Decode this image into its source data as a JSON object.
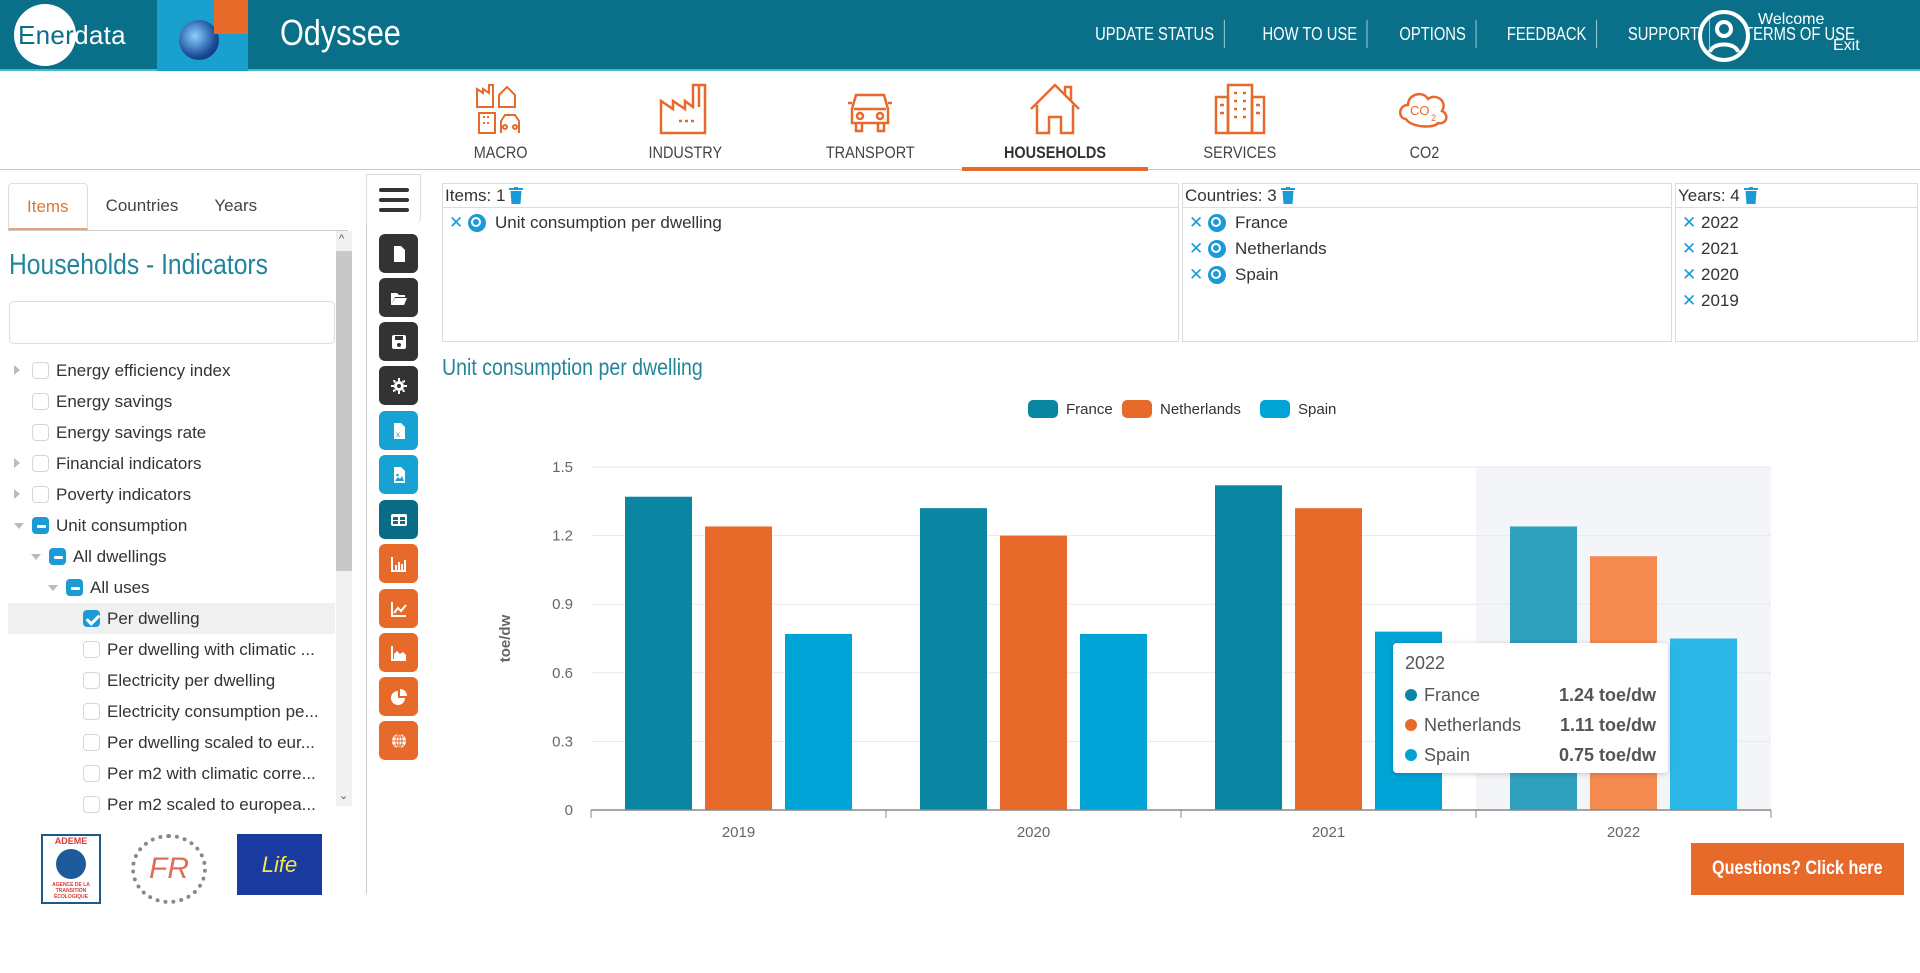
{
  "header": {
    "brand_left": "Ener",
    "brand_right": "data",
    "app_title": "Odyssee",
    "nav": [
      "UPDATE STATUS",
      "HOW TO USE",
      "OPTIONS",
      "FEEDBACK",
      "SUPPORT",
      "TERMS OF USE"
    ],
    "welcome": "Welcome",
    "exit": "Exit"
  },
  "categories": [
    {
      "label": "MACRO",
      "icon": "macro-icon",
      "active": false
    },
    {
      "label": "INDUSTRY",
      "icon": "factory-icon",
      "active": false
    },
    {
      "label": "TRANSPORT",
      "icon": "car-icon",
      "active": false
    },
    {
      "label": "HOUSEHOLDS",
      "icon": "house-icon",
      "active": true
    },
    {
      "label": "SERVICES",
      "icon": "building-icon",
      "active": false
    },
    {
      "label": "CO2",
      "icon": "co2-cloud-icon",
      "active": false
    }
  ],
  "left_panel": {
    "tabs": [
      "Items",
      "Countries",
      "Years"
    ],
    "active_tab": "Items",
    "title": "Households - Indicators",
    "search_value": "",
    "tree": [
      {
        "label": "Energy efficiency index",
        "level": 0,
        "caret": "right",
        "state": "unchecked"
      },
      {
        "label": "Energy savings",
        "level": 0,
        "caret": "none",
        "state": "unchecked"
      },
      {
        "label": "Energy savings rate",
        "level": 0,
        "caret": "none",
        "state": "unchecked"
      },
      {
        "label": "Financial indicators",
        "level": 0,
        "caret": "right",
        "state": "unchecked"
      },
      {
        "label": "Poverty indicators",
        "level": 0,
        "caret": "right",
        "state": "unchecked"
      },
      {
        "label": "Unit consumption",
        "level": 0,
        "caret": "down",
        "state": "partial"
      },
      {
        "label": "All dwellings",
        "level": 1,
        "caret": "down",
        "state": "partial"
      },
      {
        "label": "All uses",
        "level": 2,
        "caret": "down",
        "state": "partial"
      },
      {
        "label": "Per dwelling",
        "level": 3,
        "caret": "none",
        "state": "checked",
        "selected": true
      },
      {
        "label": "Per dwelling with climatic ...",
        "level": 3,
        "caret": "none",
        "state": "unchecked"
      },
      {
        "label": "Electricity per dwelling",
        "level": 3,
        "caret": "none",
        "state": "unchecked"
      },
      {
        "label": "Electricity consumption pe...",
        "level": 3,
        "caret": "none",
        "state": "unchecked"
      },
      {
        "label": "Per dwelling scaled to eur...",
        "level": 3,
        "caret": "none",
        "state": "unchecked"
      },
      {
        "label": "Per m2 with climatic corre...",
        "level": 3,
        "caret": "none",
        "state": "unchecked"
      },
      {
        "label": "Per m2 scaled to europea...",
        "level": 3,
        "caret": "none",
        "state": "unchecked"
      }
    ],
    "logos": {
      "ademe": "ADEME",
      "ademe_sub": "AGENCE DE LA TRANSITION ÉCOLOGIQUE",
      "fr": "FR",
      "life": "Life"
    }
  },
  "toolbar": [
    {
      "icon": "new-file-icon",
      "color": "dark"
    },
    {
      "icon": "folder-open-icon",
      "color": "dark"
    },
    {
      "icon": "save-icon",
      "color": "dark"
    },
    {
      "icon": "gear-icon",
      "color": "dark"
    },
    {
      "icon": "excel-export-icon",
      "color": "blue"
    },
    {
      "icon": "image-export-icon",
      "color": "blue"
    },
    {
      "icon": "table-view-icon",
      "color": "teal"
    },
    {
      "icon": "bar-chart-icon",
      "color": "orange"
    },
    {
      "icon": "line-chart-icon",
      "color": "orange"
    },
    {
      "icon": "area-chart-icon",
      "color": "orange"
    },
    {
      "icon": "pie-chart-icon",
      "color": "orange"
    },
    {
      "icon": "globe-map-icon",
      "color": "orange"
    }
  ],
  "selection": {
    "items": {
      "label": "Items: 1",
      "values": [
        "Unit consumption per dwelling"
      ]
    },
    "countries": {
      "label": "Countries: 3",
      "values": [
        "France",
        "Netherlands",
        "Spain"
      ]
    },
    "years": {
      "label": "Years: 4",
      "values": [
        "2022",
        "2021",
        "2020",
        "2019"
      ]
    }
  },
  "colors": {
    "brand": "#0a7089",
    "accent": "#e86a2b",
    "france": "#0a86a3",
    "netherlands": "#e86a2b",
    "spain": "#00a3d6"
  },
  "chart_data": {
    "type": "bar",
    "title": "Unit consumption per dwelling",
    "categories": [
      "2019",
      "2020",
      "2021",
      "2022"
    ],
    "series": [
      {
        "name": "France",
        "values": [
          1.37,
          1.32,
          1.42,
          1.24
        ]
      },
      {
        "name": "Netherlands",
        "values": [
          1.24,
          1.2,
          1.32,
          1.11
        ]
      },
      {
        "name": "Spain",
        "values": [
          0.77,
          0.77,
          0.78,
          0.75
        ]
      }
    ],
    "xlabel": "",
    "ylabel": "toe/dw",
    "ylim": [
      0,
      1.5
    ],
    "yticks": [
      "0",
      "0.3",
      "0.6",
      "0.9",
      "1.2",
      "1.5"
    ],
    "grid": true,
    "legend": "top-center",
    "highlighted_category": "2022"
  },
  "tooltip": {
    "title": "2022",
    "rows": [
      {
        "name": "France",
        "value": "1.24 toe/dw"
      },
      {
        "name": "Netherlands",
        "value": "1.11 toe/dw"
      },
      {
        "name": "Spain",
        "value": "0.75 toe/dw"
      }
    ]
  },
  "questions_button": "Questions? Click here"
}
